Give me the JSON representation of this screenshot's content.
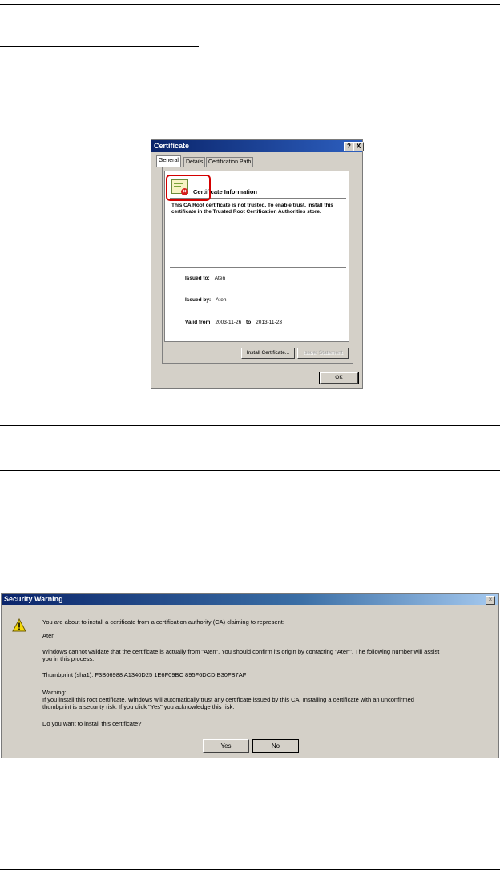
{
  "certificate_dialog": {
    "title": "Certificate",
    "help_button": "?",
    "close_button": "X",
    "tabs": [
      "General",
      "Details",
      "Certification Path"
    ],
    "heading": "Certificate Information",
    "warning": "This CA Root certificate is not trusted. To enable trust, install this certificate in the Trusted Root Certification Authorities store.",
    "issued_to_label": "Issued to:",
    "issued_to_value": "Aten",
    "issued_by_label": "Issued by:",
    "issued_by_value": "Aten",
    "valid_from_label": "Valid from",
    "valid_from_value": "2003-11-26",
    "valid_to_label": "to",
    "valid_to_value": "2013-11-23",
    "install_button": "Install Certificate...",
    "issuer_statement_button": "Issuer Statement",
    "ok_button": "OK",
    "highlight_color": "#d40000"
  },
  "security_warning": {
    "title": "Security Warning",
    "close_button": "×",
    "line1": "You are about to install a certificate from a certification authority (CA) claiming to represent:",
    "line2": "Aten",
    "line3a": "Windows cannot validate that the certificate is actually from \"Aten\". You should confirm its origin by contacting \"Aten\". The following number will assist",
    "line3b": "you in this process:",
    "thumbprint": "Thumbprint (sha1): F3B66988 A1340D25 1E6F09BC 895F6DCD B30FB7AF",
    "warning_label": "Warning:",
    "warning_a": "If you install this root certificate, Windows will automatically trust any certificate issued by this CA. Installing a certificate with an unconfirmed",
    "warning_b": "thumbprint is a security risk. If you click \"Yes\" you acknowledge this risk.",
    "question": "Do you want to install this certificate?",
    "yes_button": "Yes",
    "no_button": "No",
    "icon": "warning-icon"
  }
}
